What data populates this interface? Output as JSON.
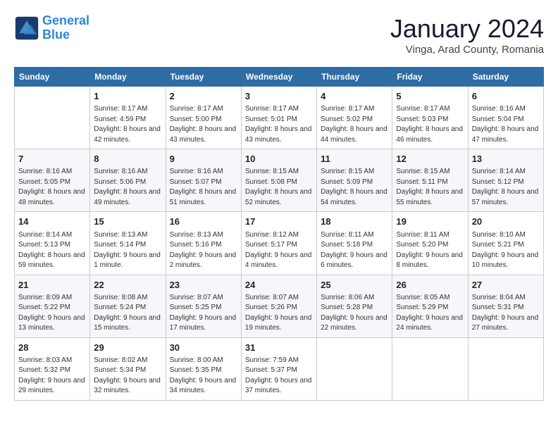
{
  "logo": {
    "line1": "General",
    "line2": "Blue"
  },
  "title": "January 2024",
  "subtitle": "Vinga, Arad County, Romania",
  "days_header": [
    "Sunday",
    "Monday",
    "Tuesday",
    "Wednesday",
    "Thursday",
    "Friday",
    "Saturday"
  ],
  "weeks": [
    [
      {
        "num": "",
        "sunrise": "",
        "sunset": "",
        "daylight": ""
      },
      {
        "num": "1",
        "sunrise": "Sunrise: 8:17 AM",
        "sunset": "Sunset: 4:59 PM",
        "daylight": "Daylight: 8 hours and 42 minutes."
      },
      {
        "num": "2",
        "sunrise": "Sunrise: 8:17 AM",
        "sunset": "Sunset: 5:00 PM",
        "daylight": "Daylight: 8 hours and 43 minutes."
      },
      {
        "num": "3",
        "sunrise": "Sunrise: 8:17 AM",
        "sunset": "Sunset: 5:01 PM",
        "daylight": "Daylight: 8 hours and 43 minutes."
      },
      {
        "num": "4",
        "sunrise": "Sunrise: 8:17 AM",
        "sunset": "Sunset: 5:02 PM",
        "daylight": "Daylight: 8 hours and 44 minutes."
      },
      {
        "num": "5",
        "sunrise": "Sunrise: 8:17 AM",
        "sunset": "Sunset: 5:03 PM",
        "daylight": "Daylight: 8 hours and 46 minutes."
      },
      {
        "num": "6",
        "sunrise": "Sunrise: 8:16 AM",
        "sunset": "Sunset: 5:04 PM",
        "daylight": "Daylight: 8 hours and 47 minutes."
      }
    ],
    [
      {
        "num": "7",
        "sunrise": "Sunrise: 8:16 AM",
        "sunset": "Sunset: 5:05 PM",
        "daylight": "Daylight: 8 hours and 48 minutes."
      },
      {
        "num": "8",
        "sunrise": "Sunrise: 8:16 AM",
        "sunset": "Sunset: 5:06 PM",
        "daylight": "Daylight: 8 hours and 49 minutes."
      },
      {
        "num": "9",
        "sunrise": "Sunrise: 8:16 AM",
        "sunset": "Sunset: 5:07 PM",
        "daylight": "Daylight: 8 hours and 51 minutes."
      },
      {
        "num": "10",
        "sunrise": "Sunrise: 8:15 AM",
        "sunset": "Sunset: 5:08 PM",
        "daylight": "Daylight: 8 hours and 52 minutes."
      },
      {
        "num": "11",
        "sunrise": "Sunrise: 8:15 AM",
        "sunset": "Sunset: 5:09 PM",
        "daylight": "Daylight: 8 hours and 54 minutes."
      },
      {
        "num": "12",
        "sunrise": "Sunrise: 8:15 AM",
        "sunset": "Sunset: 5:11 PM",
        "daylight": "Daylight: 8 hours and 55 minutes."
      },
      {
        "num": "13",
        "sunrise": "Sunrise: 8:14 AM",
        "sunset": "Sunset: 5:12 PM",
        "daylight": "Daylight: 8 hours and 57 minutes."
      }
    ],
    [
      {
        "num": "14",
        "sunrise": "Sunrise: 8:14 AM",
        "sunset": "Sunset: 5:13 PM",
        "daylight": "Daylight: 8 hours and 59 minutes."
      },
      {
        "num": "15",
        "sunrise": "Sunrise: 8:13 AM",
        "sunset": "Sunset: 5:14 PM",
        "daylight": "Daylight: 9 hours and 1 minute."
      },
      {
        "num": "16",
        "sunrise": "Sunrise: 8:13 AM",
        "sunset": "Sunset: 5:16 PM",
        "daylight": "Daylight: 9 hours and 2 minutes."
      },
      {
        "num": "17",
        "sunrise": "Sunrise: 8:12 AM",
        "sunset": "Sunset: 5:17 PM",
        "daylight": "Daylight: 9 hours and 4 minutes."
      },
      {
        "num": "18",
        "sunrise": "Sunrise: 8:11 AM",
        "sunset": "Sunset: 5:18 PM",
        "daylight": "Daylight: 9 hours and 6 minutes."
      },
      {
        "num": "19",
        "sunrise": "Sunrise: 8:11 AM",
        "sunset": "Sunset: 5:20 PM",
        "daylight": "Daylight: 9 hours and 8 minutes."
      },
      {
        "num": "20",
        "sunrise": "Sunrise: 8:10 AM",
        "sunset": "Sunset: 5:21 PM",
        "daylight": "Daylight: 9 hours and 10 minutes."
      }
    ],
    [
      {
        "num": "21",
        "sunrise": "Sunrise: 8:09 AM",
        "sunset": "Sunset: 5:22 PM",
        "daylight": "Daylight: 9 hours and 13 minutes."
      },
      {
        "num": "22",
        "sunrise": "Sunrise: 8:08 AM",
        "sunset": "Sunset: 5:24 PM",
        "daylight": "Daylight: 9 hours and 15 minutes."
      },
      {
        "num": "23",
        "sunrise": "Sunrise: 8:07 AM",
        "sunset": "Sunset: 5:25 PM",
        "daylight": "Daylight: 9 hours and 17 minutes."
      },
      {
        "num": "24",
        "sunrise": "Sunrise: 8:07 AM",
        "sunset": "Sunset: 5:26 PM",
        "daylight": "Daylight: 9 hours and 19 minutes."
      },
      {
        "num": "25",
        "sunrise": "Sunrise: 8:06 AM",
        "sunset": "Sunset: 5:28 PM",
        "daylight": "Daylight: 9 hours and 22 minutes."
      },
      {
        "num": "26",
        "sunrise": "Sunrise: 8:05 AM",
        "sunset": "Sunset: 5:29 PM",
        "daylight": "Daylight: 9 hours and 24 minutes."
      },
      {
        "num": "27",
        "sunrise": "Sunrise: 8:04 AM",
        "sunset": "Sunset: 5:31 PM",
        "daylight": "Daylight: 9 hours and 27 minutes."
      }
    ],
    [
      {
        "num": "28",
        "sunrise": "Sunrise: 8:03 AM",
        "sunset": "Sunset: 5:32 PM",
        "daylight": "Daylight: 9 hours and 29 minutes."
      },
      {
        "num": "29",
        "sunrise": "Sunrise: 8:02 AM",
        "sunset": "Sunset: 5:34 PM",
        "daylight": "Daylight: 9 hours and 32 minutes."
      },
      {
        "num": "30",
        "sunrise": "Sunrise: 8:00 AM",
        "sunset": "Sunset: 5:35 PM",
        "daylight": "Daylight: 9 hours and 34 minutes."
      },
      {
        "num": "31",
        "sunrise": "Sunrise: 7:59 AM",
        "sunset": "Sunset: 5:37 PM",
        "daylight": "Daylight: 9 hours and 37 minutes."
      },
      {
        "num": "",
        "sunrise": "",
        "sunset": "",
        "daylight": ""
      },
      {
        "num": "",
        "sunrise": "",
        "sunset": "",
        "daylight": ""
      },
      {
        "num": "",
        "sunrise": "",
        "sunset": "",
        "daylight": ""
      }
    ]
  ]
}
